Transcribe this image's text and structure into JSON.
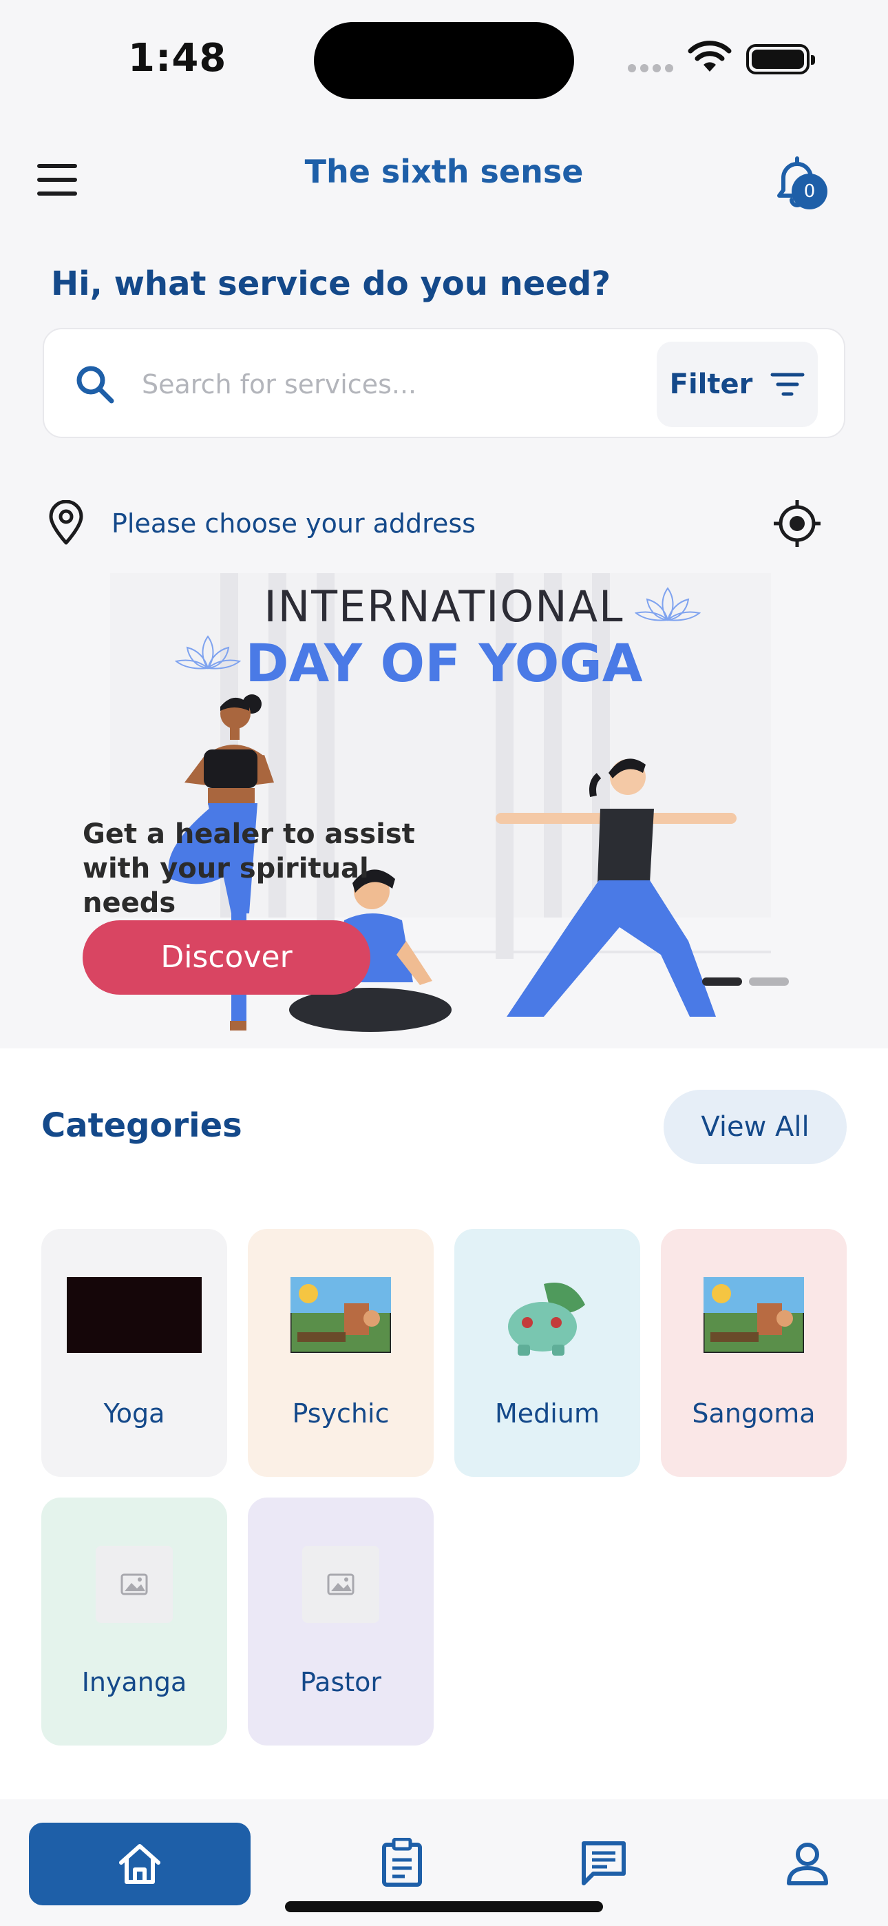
{
  "status_bar": {
    "time": "1:48"
  },
  "header": {
    "title": "The sixth sense",
    "notification_count": "0"
  },
  "greeting": "Hi, what service do you need?",
  "search": {
    "placeholder": "Search for services...",
    "filter_label": "Filter"
  },
  "address": {
    "label": "Please choose your address"
  },
  "banner": {
    "title_line1": "INTERNATIONAL",
    "title_line2": "DAY OF YOGA",
    "tagline": "Get a healer to assist with your spiritual needs",
    "button_label": "Discover",
    "slide_count": 2,
    "active_slide": 1
  },
  "categories": {
    "title": "Categories",
    "view_all_label": "View All",
    "items": [
      {
        "label": "Yoga",
        "thumb": "dark-video-thumbnail",
        "bg": "#f3f3f5"
      },
      {
        "label": "Psychic",
        "thumb": "cartoon-scene-thumbnail",
        "bg": "#fbf0e6"
      },
      {
        "label": "Medium",
        "thumb": "green-creature-image",
        "bg": "#e2f2f7"
      },
      {
        "label": "Sangoma",
        "thumb": "cartoon-scene-thumbnail",
        "bg": "#fae7e7"
      },
      {
        "label": "Inyanga",
        "thumb": "image-placeholder-icon",
        "bg": "#e4f3ec"
      },
      {
        "label": "Pastor",
        "thumb": "image-placeholder-icon",
        "bg": "#ebe8f6"
      }
    ]
  },
  "bottom_nav": {
    "items": [
      "home-icon",
      "orders-clipboard-icon",
      "messages-icon",
      "profile-icon"
    ],
    "active": "home-icon"
  },
  "colors": {
    "brand": "#1e5fa8",
    "accent": "#d94562",
    "banner_blue": "#4a7ae6"
  }
}
